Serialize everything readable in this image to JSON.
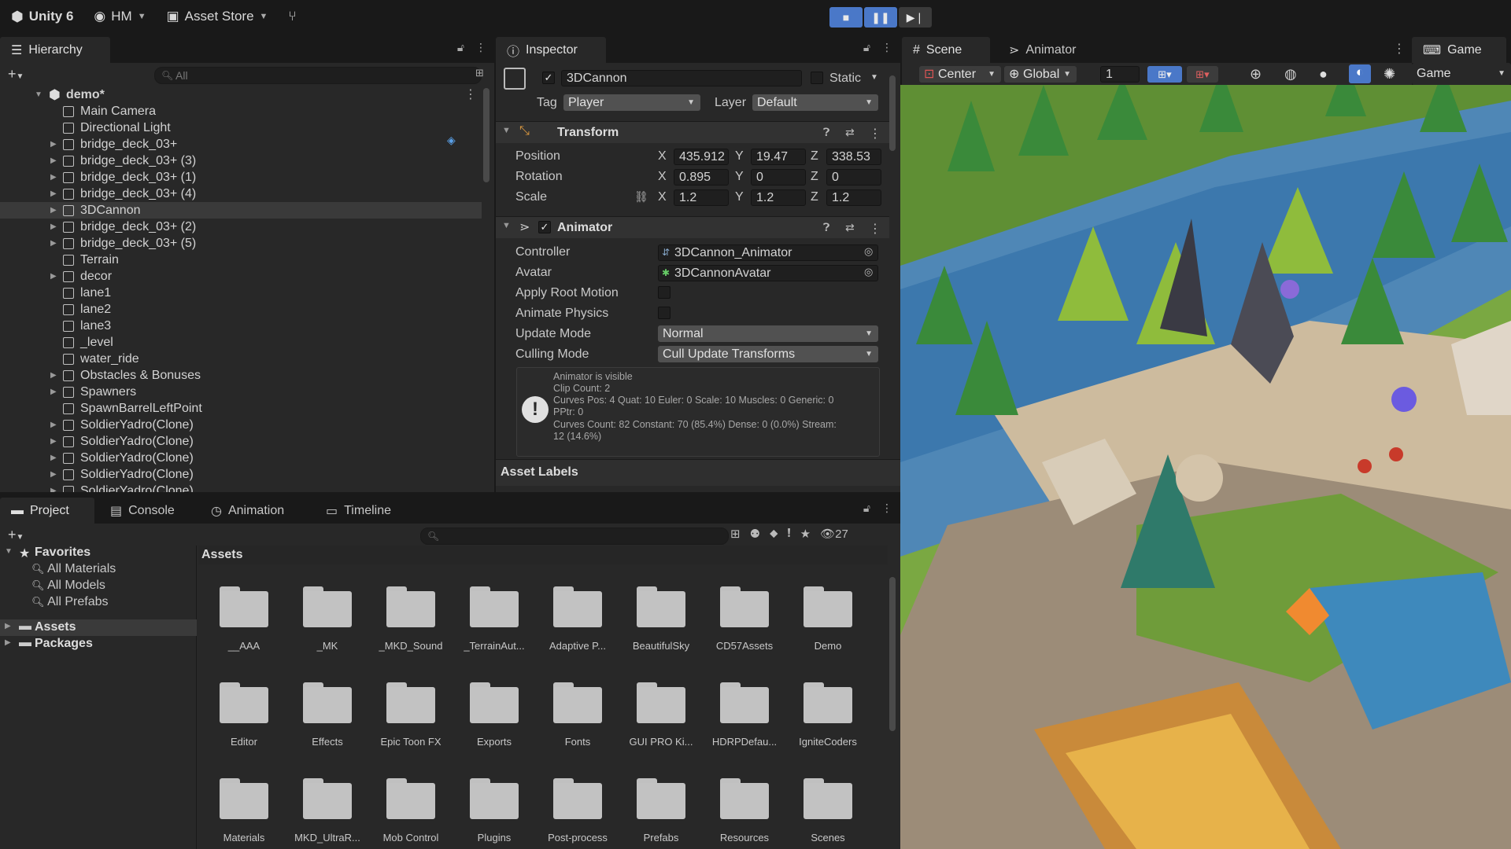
{
  "toolbar": {
    "app": "Unity 6",
    "account": "HM",
    "asset_store": "Asset Store"
  },
  "hierarchy": {
    "tab": "Hierarchy",
    "search_placeholder": "All",
    "root": "demo*",
    "items": [
      {
        "label": "Main Camera",
        "arrow": false
      },
      {
        "label": "Directional Light",
        "arrow": false
      },
      {
        "label": "bridge_deck_03+",
        "arrow": true
      },
      {
        "label": "bridge_deck_03+ (3)",
        "arrow": true
      },
      {
        "label": "bridge_deck_03+ (1)",
        "arrow": true
      },
      {
        "label": "bridge_deck_03+ (4)",
        "arrow": true
      },
      {
        "label": "3DCannon",
        "arrow": true,
        "selected": true
      },
      {
        "label": "bridge_deck_03+ (2)",
        "arrow": true
      },
      {
        "label": "bridge_deck_03+ (5)",
        "arrow": true
      },
      {
        "label": "Terrain",
        "arrow": false
      },
      {
        "label": "decor",
        "arrow": true
      },
      {
        "label": "lane1",
        "arrow": false
      },
      {
        "label": "lane2",
        "arrow": false
      },
      {
        "label": "lane3",
        "arrow": false
      },
      {
        "label": "_level",
        "arrow": false
      },
      {
        "label": "water_ride",
        "arrow": false
      },
      {
        "label": "Obstacles & Bonuses",
        "arrow": true
      },
      {
        "label": "Spawners",
        "arrow": true
      },
      {
        "label": "SpawnBarrelLeftPoint",
        "arrow": false
      },
      {
        "label": "SoldierYadro(Clone)",
        "arrow": true
      },
      {
        "label": "SoldierYadro(Clone)",
        "arrow": true
      },
      {
        "label": "SoldierYadro(Clone)",
        "arrow": true
      },
      {
        "label": "SoldierYadro(Clone)",
        "arrow": true
      },
      {
        "label": "SoldierYadro(Clone)",
        "arrow": true
      }
    ]
  },
  "inspector": {
    "tab": "Inspector",
    "object_name": "3DCannon",
    "static_label": "Static",
    "tag_label": "Tag",
    "tag_value": "Player",
    "layer_label": "Layer",
    "layer_value": "Default",
    "transform": {
      "title": "Transform",
      "position_label": "Position",
      "rotation_label": "Rotation",
      "scale_label": "Scale",
      "axis_x": "X",
      "axis_y": "Y",
      "axis_z": "Z",
      "position": {
        "x": "435.912",
        "y": "19.47",
        "z": "338.53"
      },
      "rotation": {
        "x": "0.895",
        "y": "0",
        "z": "0"
      },
      "scale": {
        "x": "1.2",
        "y": "1.2",
        "z": "1.2"
      }
    },
    "animator": {
      "title": "Animator",
      "controller_label": "Controller",
      "controller_value": "3DCannon_Animator",
      "avatar_label": "Avatar",
      "avatar_value": "3DCannonAvatar",
      "apply_root_motion_label": "Apply Root Motion",
      "animate_physics_label": "Animate Physics",
      "update_mode_label": "Update Mode",
      "update_mode_value": "Normal",
      "culling_mode_label": "Culling Mode",
      "culling_mode_value": "Cull Update Transforms",
      "info": [
        "Animator is visible",
        "Clip Count: 2",
        "Curves Pos: 4 Quat: 10 Euler: 0 Scale: 10 Muscles: 0 Generic: 0",
        "PPtr: 0",
        "Curves Count: 82 Constant: 70 (85.4%) Dense: 0 (0.0%) Stream:",
        "12 (14.6%)"
      ]
    },
    "asset_labels": "Asset Labels"
  },
  "scene": {
    "tab_scene": "Scene",
    "tab_animator": "Animator",
    "tab_game": "Game",
    "pivot": "Center",
    "space": "Global",
    "grid_value": "1",
    "game_display": "Game"
  },
  "project": {
    "tabs": [
      "Project",
      "Console",
      "Animation",
      "Timeline"
    ],
    "count": "27",
    "favorites_label": "Favorites",
    "favorites": [
      "All Materials",
      "All Models",
      "All Prefabs"
    ],
    "roots": [
      "Assets",
      "Packages"
    ],
    "breadcrumb": "Assets",
    "folders": [
      "__AAA",
      "_MK",
      "_MKD_Sound",
      "_TerrainAut...",
      "Adaptive P...",
      "BeautifulSky",
      "CD57Assets",
      "Demo",
      "Editor",
      "Effects",
      "Epic Toon FX",
      "Exports",
      "Fonts",
      "GUI PRO Ki...",
      "HDRPDefau...",
      "IgniteCoders",
      "Materials",
      "MKD_UltraR...",
      "Mob Control",
      "Plugins",
      "Post-process",
      "Prefabs",
      "Resources",
      "Scenes"
    ]
  },
  "colors": {
    "accent": "#4a78c8",
    "panel": "#282828",
    "chrome": "#191919"
  }
}
